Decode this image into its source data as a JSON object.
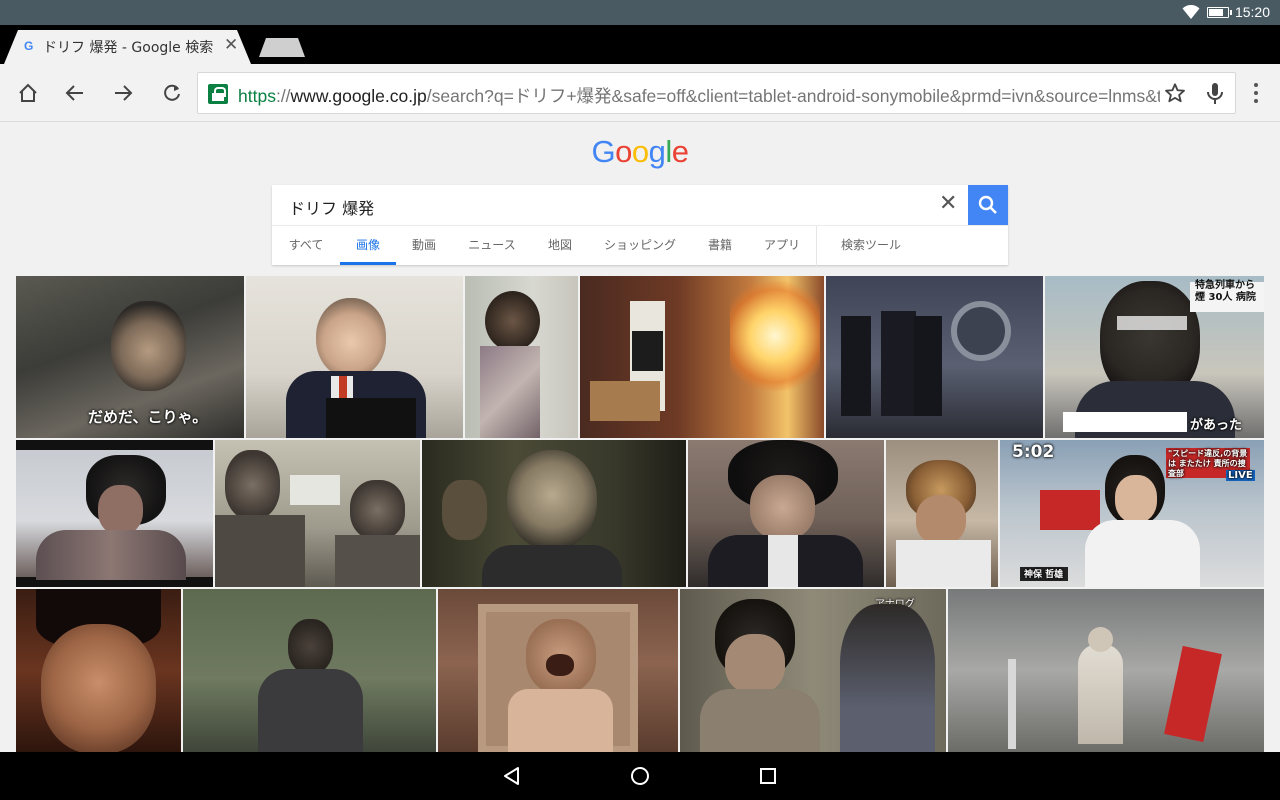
{
  "status_bar": {
    "time": "15:20",
    "battery_level": 0.7
  },
  "tab": {
    "favicon": "G",
    "title": "ドリフ 爆発 - Google 検索",
    "close_icon": "close-icon"
  },
  "toolbar": {
    "url_scheme": "https",
    "url_sep": "://",
    "url_host": "www.google.co.jp",
    "url_path": "/search?q=ドリフ+爆発&safe=off&client=tablet-android-sonymobile&prmd=ivn&source=lnms&tbm=isch"
  },
  "search": {
    "query": "ドリフ 爆発",
    "tabs": [
      "すべて",
      "画像",
      "動画",
      "ニュース",
      "地図",
      "ショッピング",
      "書籍",
      "アプリ"
    ],
    "active_tab": "画像",
    "tools": "検索ツール"
  },
  "images": {
    "caption_1": "だめだ、こりゃ。",
    "caption_6": "があった",
    "caption_6_top": "特急列車から煙 30人 病院",
    "caption_12_time": "5:02",
    "caption_12_ticker": "\"スピード違反,の背景は またたけ 責所の捜査部",
    "caption_12_live": "LIVE",
    "caption_12_name": "神保 哲雄",
    "caption_15": "アナログ"
  }
}
